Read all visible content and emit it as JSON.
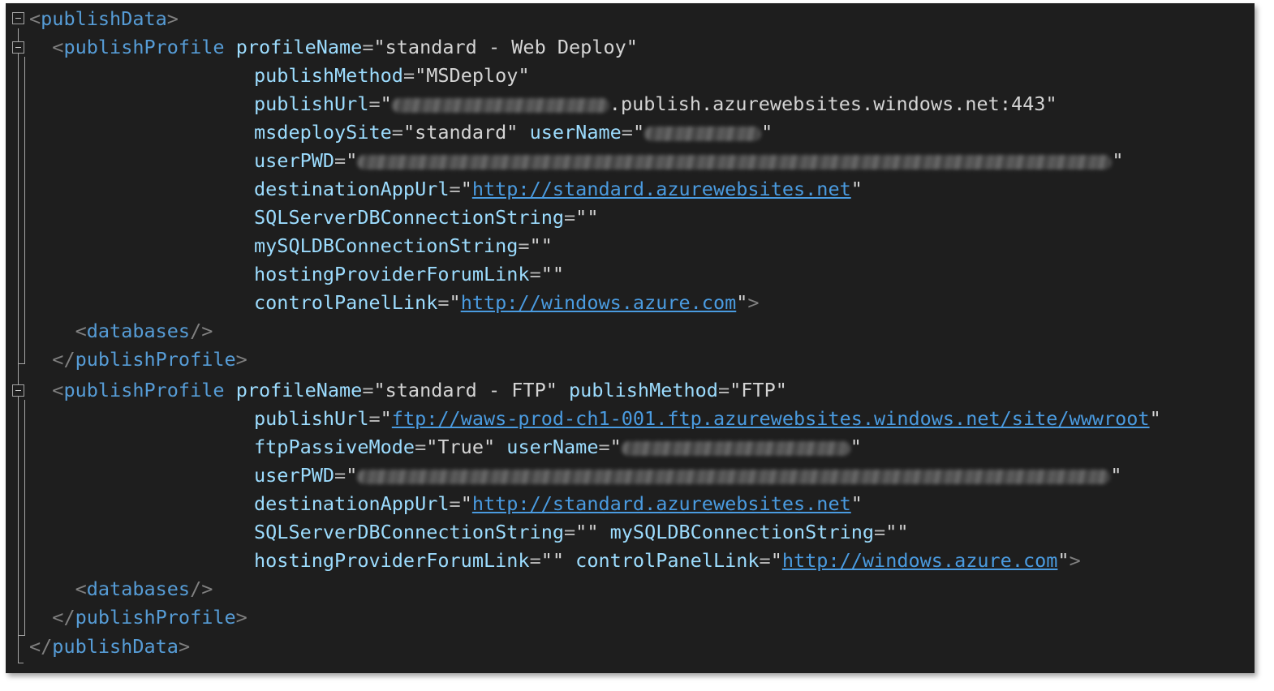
{
  "editor": {
    "tags": {
      "publishData": "publishData",
      "publishProfile": "publishProfile",
      "databases": "databases"
    },
    "attrs": {
      "profileName": "profileName",
      "publishMethod": "publishMethod",
      "publishUrl": "publishUrl",
      "msdeploySite": "msdeploySite",
      "userName": "userName",
      "userPWD": "userPWD",
      "destinationAppUrl": "destinationAppUrl",
      "sqlConn": "SQLServerDBConnectionString",
      "mySqlConn": "mySQLDBConnectionString",
      "forumLink": "hostingProviderForumLink",
      "controlPanelLink": "controlPanelLink",
      "ftpPassiveMode": "ftpPassiveMode"
    },
    "webdeploy": {
      "profileName": "standard - Web Deploy",
      "publishMethod": "MSDeploy",
      "publishUrl_suffix": ".publish.azurewebsites.windows.net:443",
      "msdeploySite": "standard",
      "destinationAppUrl": "http://standard.azurewebsites.net",
      "controlPanelLink": "http://windows.azure.com"
    },
    "ftp": {
      "profileName": "standard - FTP",
      "publishMethod": "FTP",
      "publishUrl": "ftp://waws-prod-ch1-001.ftp.azurewebsites.windows.net/site/wwwroot",
      "ftpPassiveMode": "True",
      "destinationAppUrl": "http://standard.azurewebsites.net",
      "controlPanelLink": "http://windows.azure.com"
    }
  }
}
